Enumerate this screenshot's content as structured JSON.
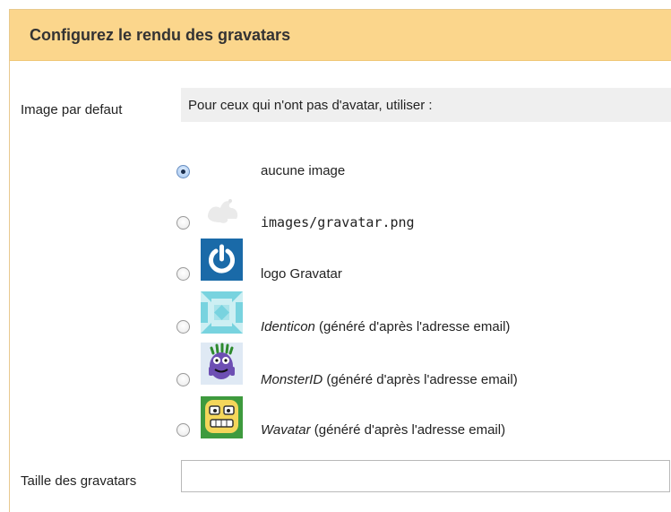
{
  "header": {
    "title": "Configurez le rendu des gravatars"
  },
  "default_image": {
    "label": "Image par defaut",
    "hint": "Pour ceux qui n'ont pas d'avatar, utiliser :",
    "options": [
      {
        "text": "aucune image",
        "suffix": "",
        "checked": true,
        "icon": "none"
      },
      {
        "text": "images/gravatar.png",
        "suffix": "",
        "checked": false,
        "icon": "squirrel-placeholder-icon"
      },
      {
        "text": "logo Gravatar",
        "suffix": "",
        "checked": false,
        "icon": "gravatar-logo-icon"
      },
      {
        "text": "Identicon",
        "suffix": " (généré d'après l'adresse email)",
        "checked": false,
        "icon": "identicon-icon"
      },
      {
        "text": "MonsterID",
        "suffix": " (généré d'après l'adresse email)",
        "checked": false,
        "icon": "monsterid-icon"
      },
      {
        "text": "Wavatar",
        "suffix": " (généré d'après l'adresse email)",
        "checked": false,
        "icon": "wavatar-icon"
      }
    ]
  },
  "size": {
    "label": "Taille des gravatars",
    "value": ""
  },
  "colors": {
    "header_bg": "#fbd68c",
    "hint_bg": "#efefef",
    "gravatar_blue": "#1a6aa8"
  }
}
